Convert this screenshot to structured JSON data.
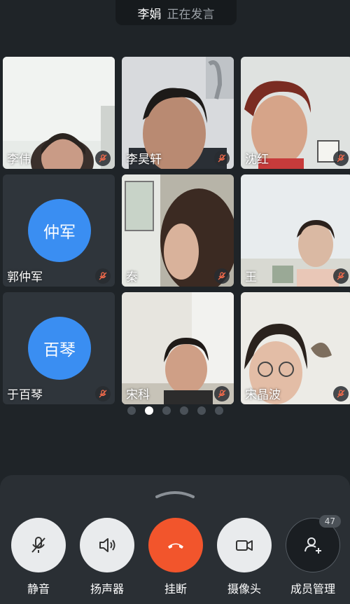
{
  "speaker": {
    "name": "李娟",
    "status": "正在发言"
  },
  "participants": [
    {
      "name": "李伟",
      "kind": "video",
      "muted": true
    },
    {
      "name": "李昊轩",
      "kind": "video",
      "muted": true
    },
    {
      "name": "沈红",
      "kind": "video",
      "muted": true
    },
    {
      "name": "郭仲军",
      "kind": "avatar",
      "avatar_text": "仲军",
      "muted": true
    },
    {
      "name": "秦",
      "kind": "video",
      "muted": true
    },
    {
      "name": "王",
      "kind": "video",
      "muted": true
    },
    {
      "name": "于百琴",
      "kind": "avatar",
      "avatar_text": "百琴",
      "muted": true
    },
    {
      "name": "宋科",
      "kind": "video",
      "muted": true
    },
    {
      "name": "宋晶波",
      "kind": "video",
      "muted": true
    }
  ],
  "pager": {
    "total": 6,
    "active_index": 1
  },
  "controls": {
    "mute_label": "静音",
    "speaker_label": "扬声器",
    "hangup_label": "挂断",
    "camera_label": "摄像头",
    "members_label": "成员管理",
    "member_count": "47"
  },
  "colors": {
    "accent": "#3a8ef2",
    "hangup": "#f2552c",
    "background": "#1f2428"
  }
}
